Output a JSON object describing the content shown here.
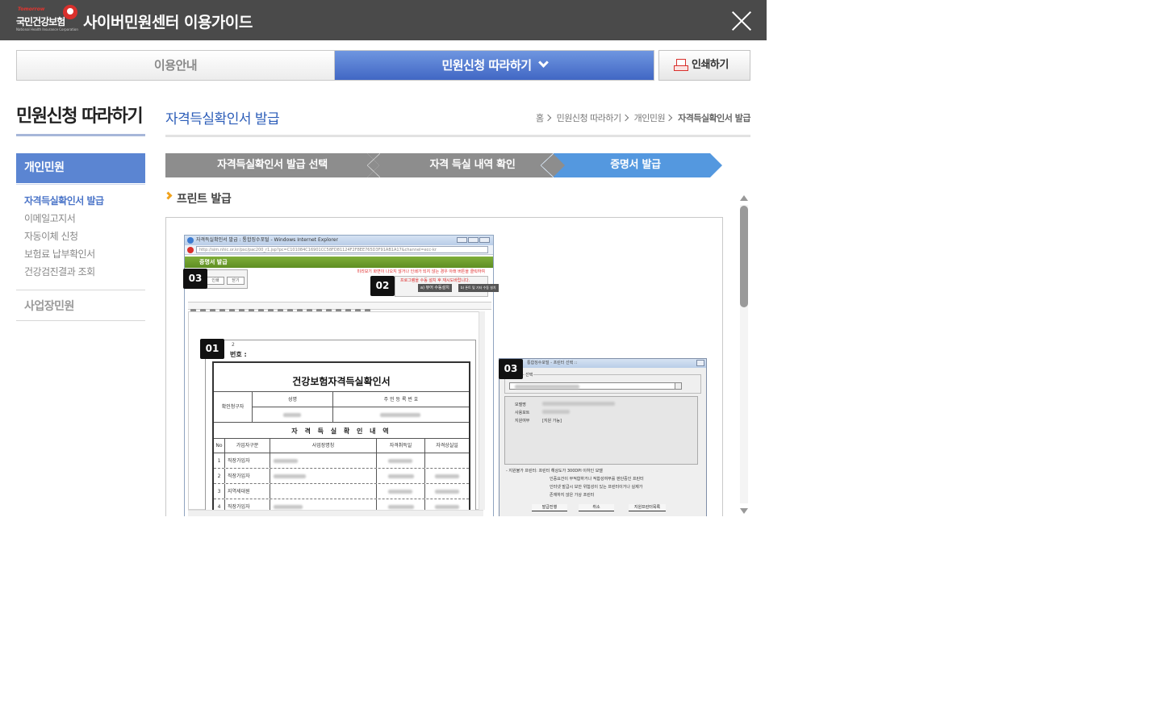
{
  "header": {
    "title": "사이버민원센터 이용가이드",
    "logo_kr": "국민건강보험",
    "logo_en": "Tomorrow",
    "logo_sub": "National Health Insurance Corporation"
  },
  "tabs": [
    {
      "label": "이용안내",
      "active": false
    },
    {
      "label": "민원신청 따라하기",
      "active": true
    }
  ],
  "print_label": "인쇄하기",
  "sidebar": {
    "title": "민원신청 따라하기",
    "active_section": "개인민원",
    "items": [
      {
        "label": "자격득실확인서 발급",
        "active": true
      },
      {
        "label": "이메일고지서",
        "active": false
      },
      {
        "label": "자동이체 신청",
        "active": false
      },
      {
        "label": "보험료 납부확인서",
        "active": false
      },
      {
        "label": "건강검진결과 조회",
        "active": false
      }
    ],
    "other_section": "사업장민원"
  },
  "content": {
    "page_title": "자격득실확인서 발급",
    "breadcrumb": [
      "홈",
      "민원신청 따라하기",
      "개인민원",
      "자격득실확인서 발급"
    ],
    "steps": [
      {
        "label": "자격득실확인서 발급 선택",
        "active": false
      },
      {
        "label": "자격 득실 내역 확인",
        "active": false
      },
      {
        "label": "증명서 발급",
        "active": true
      }
    ],
    "section_title": "프린트 발급"
  },
  "figure": {
    "ie_title": "자격득실확인서 발급 : 통합징수포털 - Windows Internet Explorer",
    "ie_url": "http://sim.nhic.or.kr/psc/pac200_r1.jsp?pc=C101084C16901CC58FD81124F2F8EE765D3F91AB1A17&channel=ecc-kr",
    "green_bar": "증명서 발급",
    "warn_text": "미리보기 화면이 나오지 않거나 인쇄가 되지 않는 경우 아래 버튼을 클릭하여",
    "btn_print": "인쇄",
    "btn_close": "닫기",
    "plug_text": "프로그램을 수동 설치 후 재시도바랍니다.",
    "plug_btn1": "a) 뷰어 수동설치",
    "plug_btn2": "b) 폰트 및 기타 수동 설치",
    "cert_page": "2",
    "cert_no": "번호 :",
    "cert_title": "건강보험자격득실확인서",
    "cert_confirm": "확인청구자",
    "cert_name": "성명",
    "cert_rrn": "주 민 등 록 번 호",
    "cert_sub": "자 격 득 실 확 인 내 역",
    "cert_cols": [
      "No",
      "가입자구분",
      "사업장명칭",
      "자격취득일",
      "자격상실일"
    ],
    "cert_rows": [
      {
        "no": "1",
        "type": "직장가입자"
      },
      {
        "no": "2",
        "type": "직장가입자"
      },
      {
        "no": "3",
        "type": "지역세대원"
      },
      {
        "no": "4",
        "type": "직장가입자"
      }
    ],
    "dlg_title": "통합징수포털 - 프린터 선택 ::",
    "dlg_group": "선택",
    "dlg_model": "모델명",
    "dlg_port": "사용포트",
    "dlg_support": "지원여부",
    "dlg_support_val": "[지원 가능]",
    "dlg_note1": "- 지원불가 프린터: 프린터 해상도가 300DPI 이하인 모델",
    "dlg_note2": "인증요건이 부적합하거나 적합성여부를 판단중인 프린터",
    "dlg_note3": "인터넷 발급시 보안 위험성이 있는 프린터이거나 실제가",
    "dlg_note4": "존재하지 않은 가상 프린터",
    "dlg_btn_issue": "발급진행",
    "dlg_btn_cancel": "취소",
    "dlg_btn_list": "지원프린터목록",
    "badges": [
      "03",
      "02",
      "01",
      "03"
    ]
  },
  "colors": {
    "header_bg": "#4a4a4a",
    "active_tab": "#4a72c8",
    "step_active": "#5498df",
    "step_inactive": "#8d8d8d",
    "title_blue": "#2b5cb8"
  }
}
